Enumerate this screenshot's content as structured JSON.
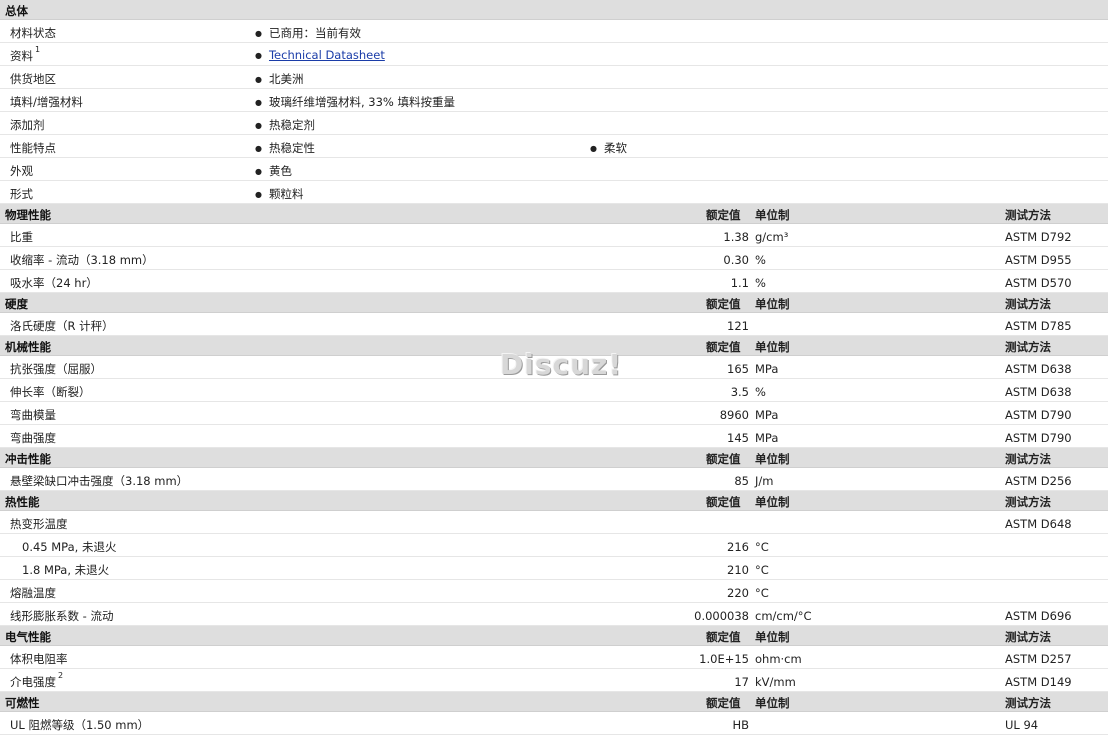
{
  "general": {
    "title": "总体",
    "rows": [
      {
        "label": "材料状态",
        "items": [
          "已商用：当前有效"
        ]
      },
      {
        "label": "资料",
        "sup": "1",
        "link": "Technical Datasheet"
      },
      {
        "label": "供货地区",
        "items": [
          "北美洲"
        ]
      },
      {
        "label": "填料/增强材料",
        "items": [
          "玻璃纤维增强材料, 33% 填料按重量"
        ]
      },
      {
        "label": "添加剂",
        "items": [
          "热稳定剂"
        ]
      },
      {
        "label": "性能特点",
        "items": [
          "热稳定性",
          "柔软"
        ]
      },
      {
        "label": "外观",
        "items": [
          "黄色"
        ]
      },
      {
        "label": "形式",
        "items": [
          "颗粒料"
        ]
      }
    ]
  },
  "headers": {
    "nominal": "额定值",
    "unit": "单位制",
    "method": "测试方法"
  },
  "sections": [
    {
      "title": "物理性能",
      "rows": [
        {
          "label": "比重",
          "value": "1.38",
          "unit": "g/cm³",
          "method": "ASTM D792"
        },
        {
          "label": "收缩率 - 流动（3.18 mm）",
          "value": "0.30",
          "unit": "%",
          "method": "ASTM D955"
        },
        {
          "label": "吸水率（24 hr）",
          "value": "1.1",
          "unit": "%",
          "method": "ASTM D570"
        }
      ]
    },
    {
      "title": "硬度",
      "rows": [
        {
          "label": "洛氏硬度（R 计秤）",
          "value": "121",
          "unit": "",
          "method": "ASTM D785"
        }
      ]
    },
    {
      "title": "机械性能",
      "rows": [
        {
          "label": "抗张强度（屈服）",
          "value": "165",
          "unit": "MPa",
          "method": "ASTM D638"
        },
        {
          "label": "伸长率（断裂）",
          "value": "3.5",
          "unit": "%",
          "method": "ASTM D638"
        },
        {
          "label": "弯曲模量",
          "value": "8960",
          "unit": "MPa",
          "method": "ASTM D790"
        },
        {
          "label": "弯曲强度",
          "value": "145",
          "unit": "MPa",
          "method": "ASTM D790"
        }
      ]
    },
    {
      "title": "冲击性能",
      "rows": [
        {
          "label": "悬壁梁缺口冲击强度（3.18 mm）",
          "value": "85",
          "unit": "J/m",
          "method": "ASTM D256"
        }
      ]
    },
    {
      "title": "热性能",
      "rows": [
        {
          "label": "热变形温度",
          "value": "",
          "unit": "",
          "method": "ASTM D648"
        },
        {
          "label": "0.45 MPa, 未退火",
          "indent": true,
          "value": "216",
          "unit": "°C",
          "method": ""
        },
        {
          "label": "1.8 MPa, 未退火",
          "indent": true,
          "value": "210",
          "unit": "°C",
          "method": ""
        },
        {
          "label": "熔融温度",
          "value": "220",
          "unit": "°C",
          "method": ""
        },
        {
          "label": "线形膨胀系数 - 流动",
          "value": "0.000038",
          "unit": "cm/cm/°C",
          "method": "ASTM D696"
        }
      ]
    },
    {
      "title": "电气性能",
      "rows": [
        {
          "label": "体积电阻率",
          "value": "1.0E+15",
          "unit": "ohm·cm",
          "method": "ASTM D257"
        },
        {
          "label": "介电强度",
          "sup": "2",
          "value": "17",
          "unit": "kV/mm",
          "method": "ASTM D149"
        }
      ]
    },
    {
      "title": "可燃性",
      "rows": [
        {
          "label": "UL 阻燃等级（1.50 mm）",
          "value": "HB",
          "unit": "",
          "method": "UL 94"
        }
      ]
    }
  ],
  "watermark": "Discuz!"
}
